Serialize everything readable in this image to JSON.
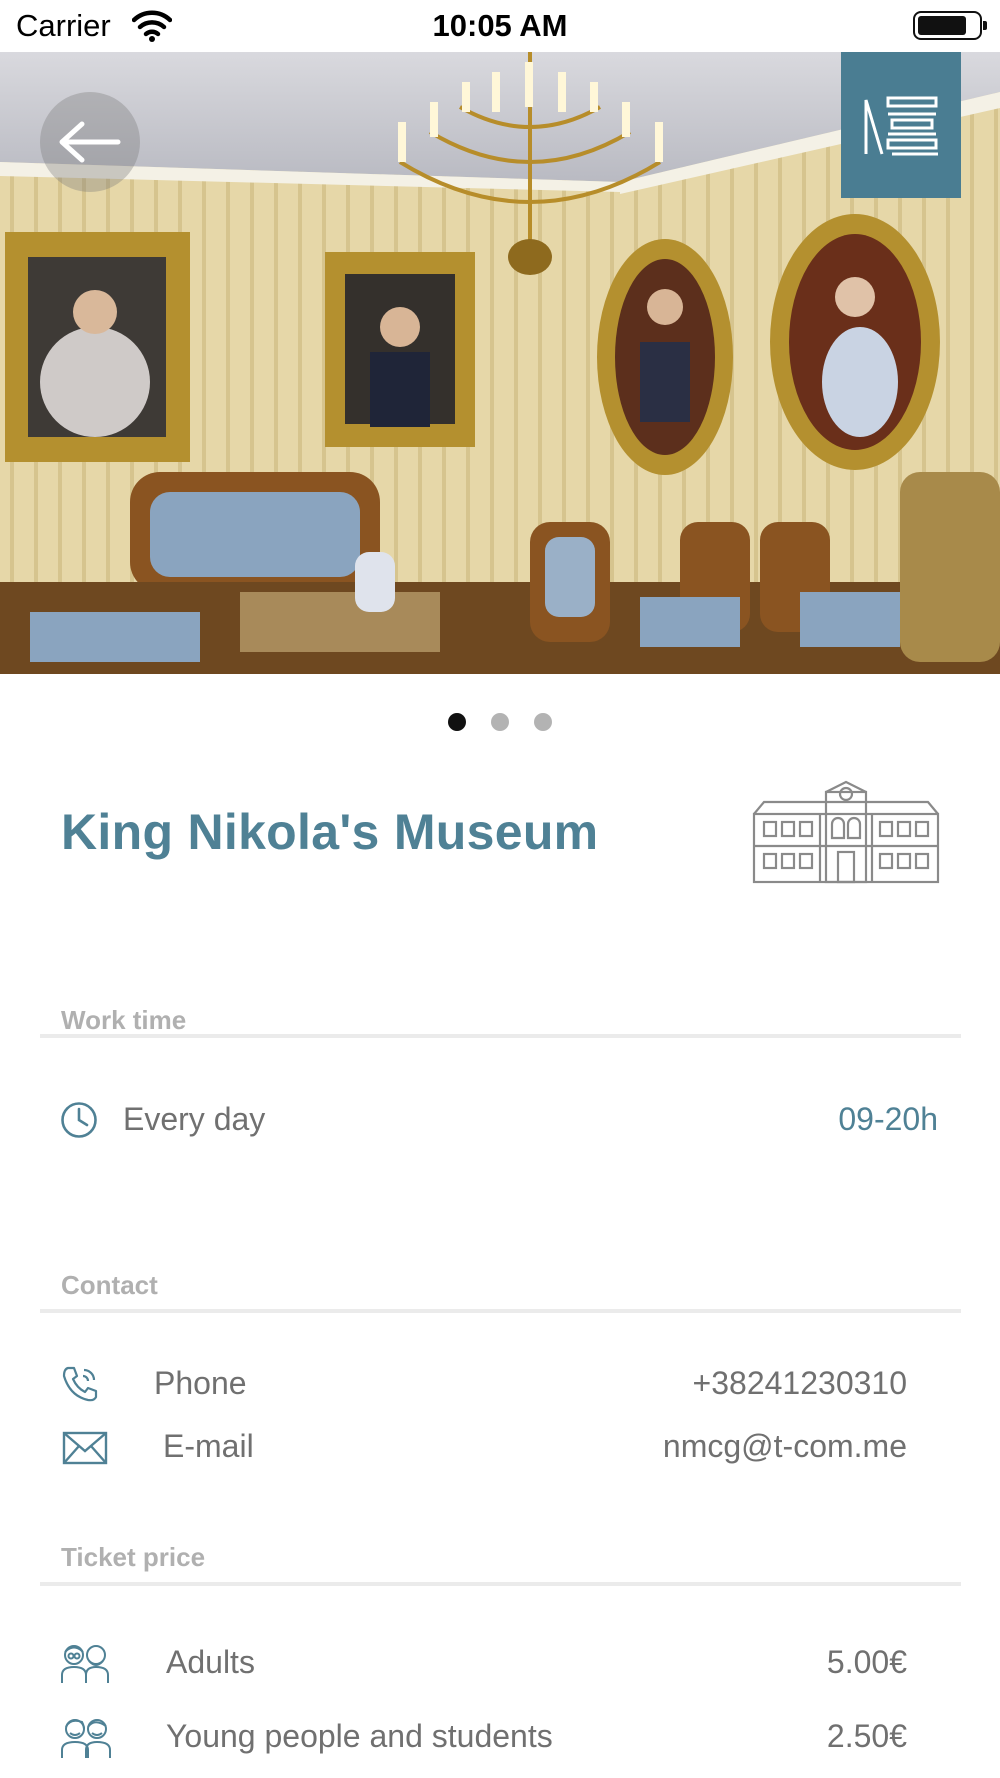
{
  "status_bar": {
    "carrier": "Carrier",
    "time": "10:05 AM"
  },
  "gallery": {
    "slide_count": 3,
    "active_index": 0
  },
  "museum": {
    "title": "King Nikola's Museum"
  },
  "work_time": {
    "section_label": "Work time",
    "day_label": "Every day",
    "hours": "09-20h"
  },
  "contact": {
    "section_label": "Contact",
    "phone_label": "Phone",
    "phone_value": "+38241230310",
    "email_label": "E-mail",
    "email_value": "nmcg@t-com.me"
  },
  "tickets": {
    "section_label": "Ticket price",
    "items": [
      {
        "label": "Adults",
        "price": "5.00€"
      },
      {
        "label": "Young people and students",
        "price": "2.50€"
      }
    ]
  },
  "colors": {
    "accent": "#4f8195",
    "logo_tile": "#4a7d92"
  }
}
